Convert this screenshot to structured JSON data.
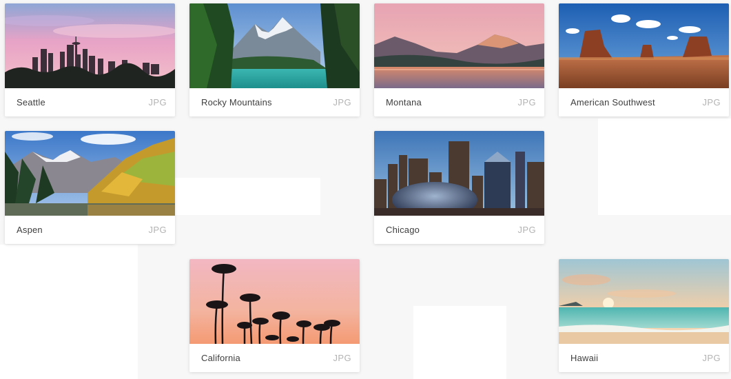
{
  "gallery": {
    "items": [
      {
        "title": "Seattle",
        "type": "JPG"
      },
      {
        "title": "Rocky Mountains",
        "type": "JPG"
      },
      {
        "title": "Montana",
        "type": "JPG"
      },
      {
        "title": "American Southwest",
        "type": "JPG"
      },
      {
        "title": "Aspen",
        "type": "JPG"
      },
      {
        "title": "Chicago",
        "type": "JPG"
      },
      {
        "title": "California",
        "type": "JPG"
      },
      {
        "title": "Hawaii",
        "type": "JPG"
      }
    ]
  },
  "colors": {
    "page_background": "#f7f7f7",
    "card_background": "#ffffff",
    "title_text": "#3d3d3d",
    "type_text": "#b3b3b3"
  }
}
